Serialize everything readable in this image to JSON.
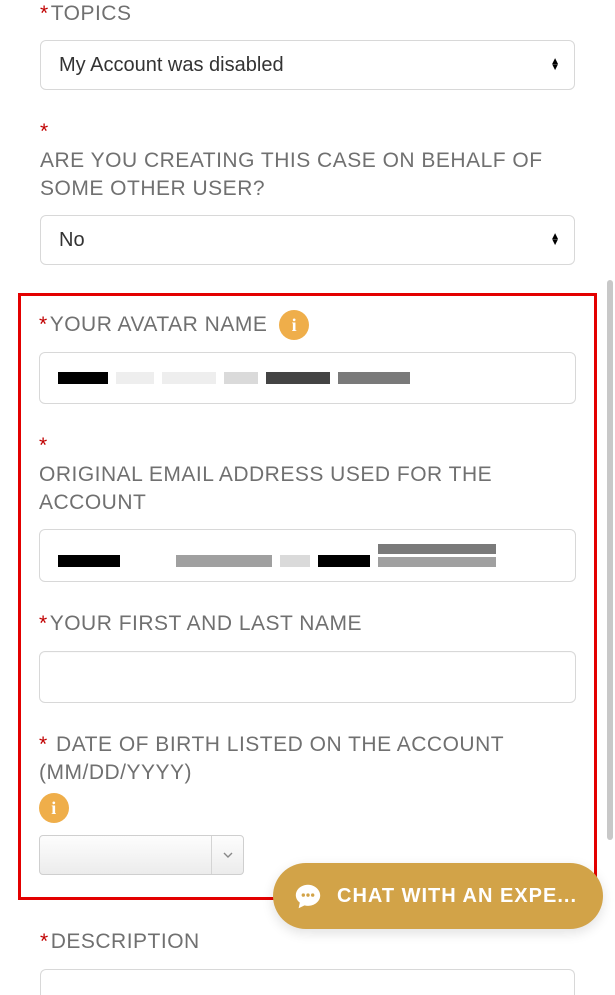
{
  "topics": {
    "label": "TOPICS",
    "value": "My Account was disabled"
  },
  "onBehalf": {
    "label": "ARE YOU CREATING THIS CASE ON BEHALF OF SOME OTHER USER?",
    "value": "No"
  },
  "avatar": {
    "label": "YOUR AVATAR NAME"
  },
  "email": {
    "label": "ORIGINAL EMAIL ADDRESS USED FOR THE ACCOUNT"
  },
  "name": {
    "label": "YOUR FIRST AND LAST NAME",
    "value": ""
  },
  "dob": {
    "label": "DATE OF BIRTH LISTED ON THE ACCOUNT (MM/DD/YYYY)"
  },
  "description": {
    "label": "DESCRIPTION"
  },
  "chat": {
    "label": "CHAT WITH AN EXPE..."
  }
}
